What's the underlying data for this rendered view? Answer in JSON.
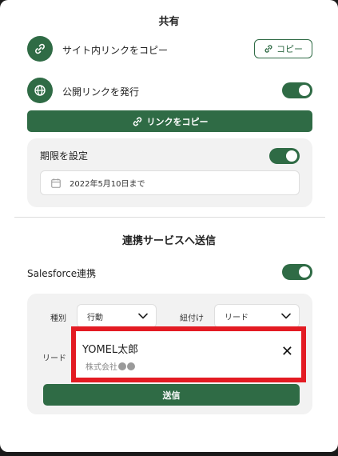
{
  "share": {
    "title": "共有",
    "site_link": {
      "label": "サイト内リンクをコピー",
      "icon": "link-icon",
      "button_label": "コピー"
    },
    "public_link": {
      "label": "公開リンクを発行",
      "icon": "globe-icon",
      "toggle_on": true,
      "copy_button_label": "リンクをコピー"
    },
    "expiry": {
      "label": "期限を設定",
      "toggle_on": true,
      "date_value": "2022年5月10日まで",
      "icon": "calendar-icon"
    }
  },
  "integration": {
    "title": "連携サービスへ送信",
    "salesforce": {
      "label": "Salesforce連携",
      "toggle_on": true
    },
    "type": {
      "label": "種別",
      "value": "行動"
    },
    "link_to": {
      "label": "紐付け",
      "value": "リード"
    },
    "lead": {
      "label": "リード",
      "name": "YOMEL太郎",
      "company": "株式会社"
    },
    "send_label": "送信"
  },
  "colors": {
    "primary": "#2f6b45",
    "highlight": "#e31b23",
    "panel_bg": "#ffffff",
    "box_bg": "#f2f2f2"
  }
}
